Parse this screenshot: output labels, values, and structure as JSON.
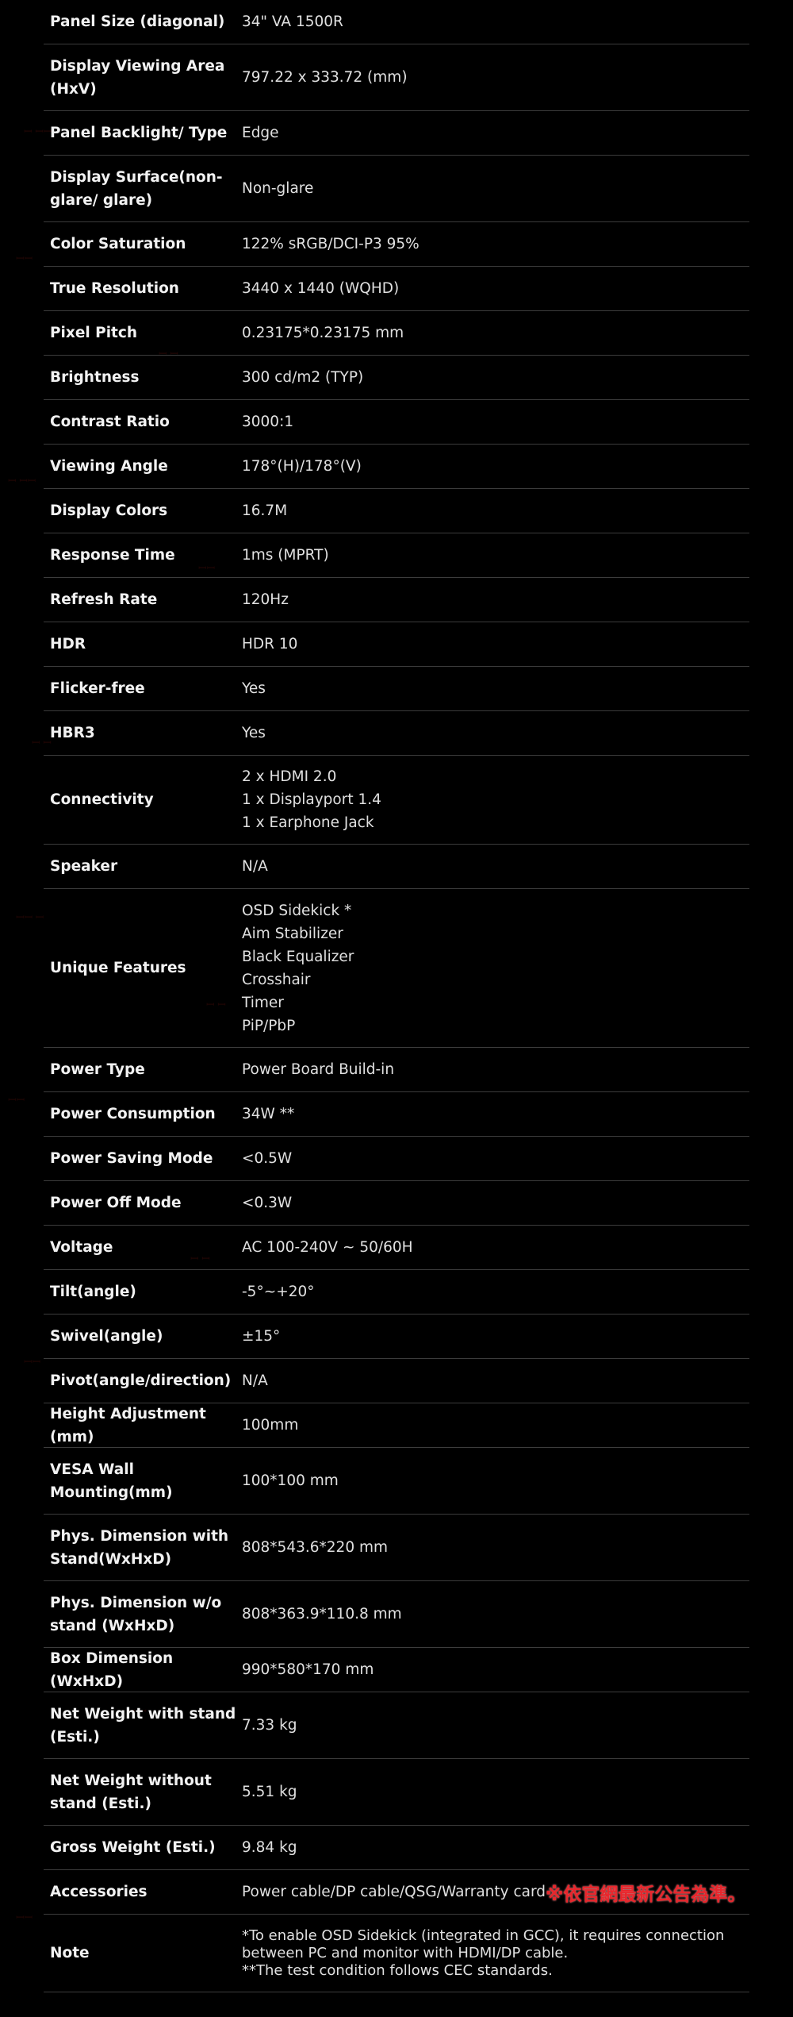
{
  "specs": [
    {
      "label": "Panel Size (diagonal)",
      "value": [
        "34\" VA 1500R"
      ]
    },
    {
      "label": "Display Viewing Area (HxV)",
      "value": [
        "797.22 x 333.72 (mm)"
      ]
    },
    {
      "label": "Panel Backlight/ Type",
      "value": [
        "Edge"
      ]
    },
    {
      "label": "Display Surface(non-glare/ glare)",
      "value": [
        "Non-glare"
      ]
    },
    {
      "label": "Color Saturation",
      "value": [
        "122% sRGB/DCI-P3 95%"
      ]
    },
    {
      "label": "True Resolution",
      "value": [
        "3440 x 1440 (WQHD)"
      ]
    },
    {
      "label": "Pixel Pitch",
      "value": [
        "0.23175*0.23175 mm"
      ]
    },
    {
      "label": "Brightness",
      "value": [
        "300 cd/m2 (TYP)"
      ]
    },
    {
      "label": "Contrast Ratio",
      "value": [
        "3000:1"
      ]
    },
    {
      "label": "Viewing Angle",
      "value": [
        "178°(H)/178°(V)"
      ]
    },
    {
      "label": "Display Colors",
      "value": [
        "16.7M"
      ]
    },
    {
      "label": "Response Time",
      "value": [
        "1ms (MPRT)"
      ]
    },
    {
      "label": "Refresh Rate",
      "value": [
        "120Hz"
      ]
    },
    {
      "label": "HDR",
      "value": [
        "HDR 10"
      ]
    },
    {
      "label": "Flicker-free",
      "value": [
        "Yes"
      ]
    },
    {
      "label": "HBR3",
      "value": [
        "Yes"
      ]
    },
    {
      "label": "Connectivity",
      "value": [
        "2 x HDMI 2.0",
        "1 x Displayport 1.4",
        "1 x Earphone Jack"
      ]
    },
    {
      "label": "Speaker",
      "value": [
        "N/A"
      ]
    },
    {
      "label": "Unique Features",
      "value": [
        "OSD Sidekick *",
        "Aim Stabilizer",
        "Black Equalizer",
        "Crosshair",
        "Timer",
        "PiP/PbP"
      ]
    },
    {
      "label": "Power Type",
      "value": [
        "Power Board Build-in"
      ]
    },
    {
      "label": "Power Consumption",
      "value": [
        "34W **"
      ]
    },
    {
      "label": "Power Saving Mode",
      "value": [
        "<0.5W"
      ]
    },
    {
      "label": "Power Off Mode",
      "value": [
        "<0.3W"
      ]
    },
    {
      "label": "Voltage",
      "value": [
        "AC 100-240V ~ 50/60H"
      ]
    },
    {
      "label": "Tilt(angle)",
      "value": [
        "-5°~+20°"
      ]
    },
    {
      "label": "Swivel(angle)",
      "value": [
        "±15°"
      ]
    },
    {
      "label": "Pivot(angle/direction)",
      "value": [
        "N/A"
      ]
    },
    {
      "label": "Height Adjustment (mm)",
      "value": [
        "100mm"
      ]
    },
    {
      "label": "VESA Wall Mounting(mm)",
      "value": [
        "100*100 mm"
      ]
    },
    {
      "label": "Phys. Dimension with Stand(WxHxD)",
      "value": [
        "808*543.6*220 mm"
      ]
    },
    {
      "label": "Phys. Dimension w/o stand  (WxHxD)",
      "value": [
        "808*363.9*110.8 mm"
      ]
    },
    {
      "label": "Box Dimension (WxHxD)",
      "value": [
        "990*580*170 mm"
      ]
    },
    {
      "label": "Net Weight with stand (Esti.)",
      "value": [
        "7.33 kg"
      ]
    },
    {
      "label": "Net Weight without stand (Esti.)",
      "value": [
        "5.51 kg"
      ]
    },
    {
      "label": "Gross Weight (Esti.)",
      "value": [
        "9.84 kg"
      ]
    },
    {
      "label": "Accessories",
      "value": [
        "Power cable/DP cable/QSG/Warranty card"
      ],
      "notice": "※依官網最新公告為準。"
    },
    {
      "label": "Note",
      "value": [
        "*To enable OSD Sidekick (integrated in GCC), it requires connection between PC and monitor with HDMI/DP cable.",
        "**The test condition follows CEC standards."
      ]
    }
  ]
}
